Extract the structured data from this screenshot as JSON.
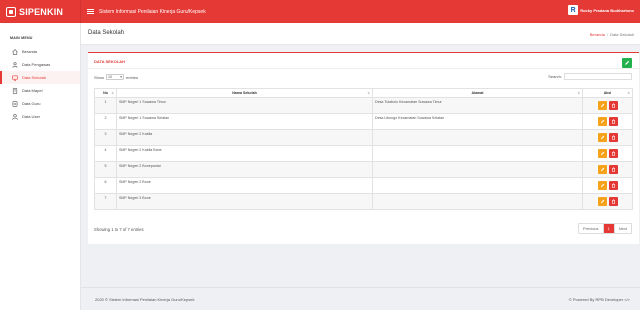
{
  "brand": {
    "name": "SIPENKIN"
  },
  "topbar": {
    "app_title": "Sistem Informasi Penilaian Kinerja Guru/Kepsek",
    "user_name": "Rocky Pradana Budihartono"
  },
  "sidebar": {
    "header": "MAIN MENU",
    "items": [
      {
        "label": "Beranda",
        "icon": "home-icon"
      },
      {
        "label": "Data Pengawas",
        "icon": "user-tie-icon"
      },
      {
        "label": "Data Sekolah",
        "icon": "monitor-icon",
        "active": true
      },
      {
        "label": "Data Mapel",
        "icon": "book-icon"
      },
      {
        "label": "Data Guru",
        "icon": "people-icon"
      },
      {
        "label": "Data User",
        "icon": "user-icon"
      }
    ]
  },
  "page": {
    "title": "Data Sekolah",
    "breadcrumb": {
      "home": "Beranda",
      "separator": "/",
      "current": "Data Sekolah"
    }
  },
  "card": {
    "title": "DATA SEKOLAH",
    "show_label": "Show",
    "entries_value": "10",
    "entries_label": "entries",
    "search_label": "Search:",
    "columns": [
      "No",
      "Nama Sekolah",
      "Alamat",
      "Aksi"
    ],
    "rows": [
      {
        "no": "1",
        "nama": "SMP Negeri 1 Suwawa Timur",
        "alamat": "Desa Tulabolo Kecamatan Suwawa Timur"
      },
      {
        "no": "2",
        "nama": "SMP Negeri 1 Suwawa Selatan",
        "alamat": "Desa Libungo Kecamatan Suwawa Selatan"
      },
      {
        "no": "3",
        "nama": "SMP Negeri 2 Kabila",
        "alamat": ""
      },
      {
        "no": "4",
        "nama": "SMP Negeri 2 Kabila Bone",
        "alamat": ""
      },
      {
        "no": "5",
        "nama": "SMP Negeri 2 Bonepantai",
        "alamat": ""
      },
      {
        "no": "6",
        "nama": "SMP Negeri 2 Bone",
        "alamat": ""
      },
      {
        "no": "7",
        "nama": "SMP Negeri 3 Bone",
        "alamat": ""
      }
    ],
    "info": "Showing 1 to 7 of 7 entries",
    "pagination": {
      "previous": "Previous",
      "current": "1",
      "next": "Next"
    }
  },
  "footer": {
    "left": "2020 © Sistem Informasi Penilaian Kinerja Guru/Kepsek",
    "right": "© Powered By RPB Developer </>"
  },
  "colors": {
    "accent": "#e53935",
    "edit": "#f7a21b",
    "add": "#22b14c",
    "delete": "#e53935"
  }
}
